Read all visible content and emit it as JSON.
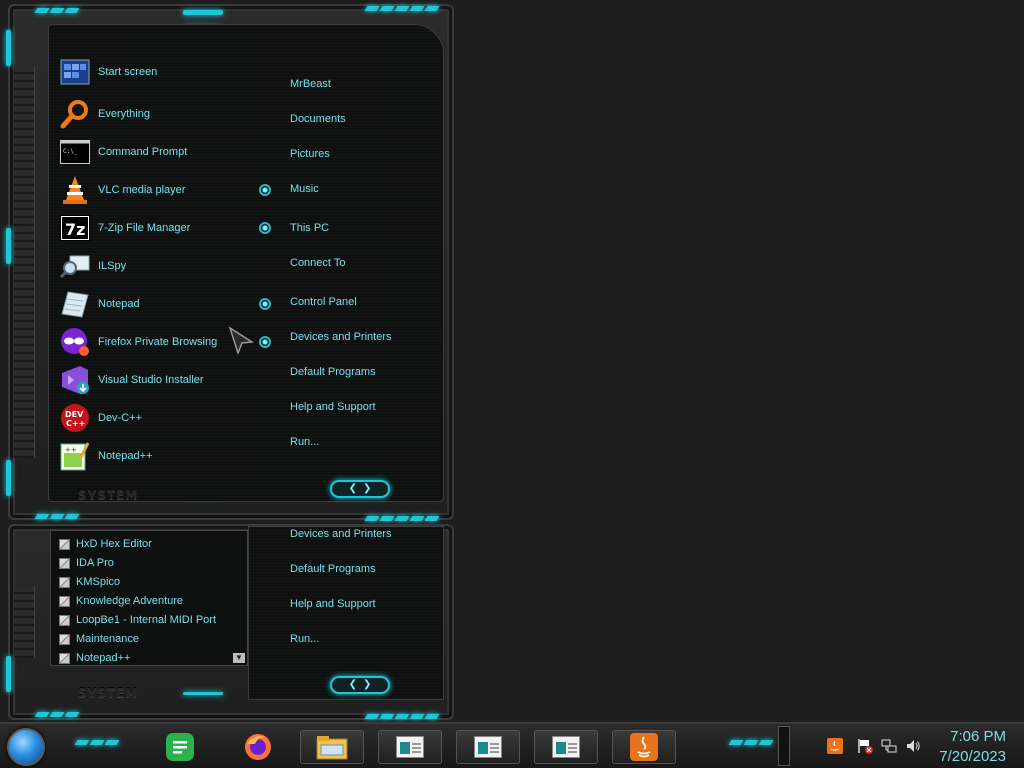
{
  "start_menu": {
    "system_label": "SYSTEM",
    "pinned": [
      {
        "label": "Start screen",
        "icon": "start-screen-icon"
      },
      {
        "label": "Everything",
        "icon": "magnifier-icon"
      },
      {
        "label": "Command Prompt",
        "icon": "terminal-icon"
      },
      {
        "label": "VLC media player",
        "icon": "vlc-cone-icon"
      },
      {
        "label": "7-Zip File Manager",
        "icon": "7zip-icon"
      },
      {
        "label": "ILSpy",
        "icon": "ilspy-icon"
      },
      {
        "label": "Notepad",
        "icon": "notepad-icon"
      },
      {
        "label": "Firefox Private Browsing",
        "icon": "firefox-private-icon"
      },
      {
        "label": "Visual Studio Installer",
        "icon": "visual-studio-icon"
      },
      {
        "label": "Dev-C++",
        "icon": "devcpp-icon"
      },
      {
        "label": "Notepad++",
        "icon": "notepadpp-icon"
      }
    ],
    "right_links": [
      "MrBeast",
      "Documents",
      "Pictures",
      "Music",
      "This PC",
      "Connect To",
      "Control Panel",
      "Devices and Printers",
      "Default Programs",
      "Help and Support",
      "Run..."
    ]
  },
  "all_programs": {
    "system_label": "SYSTEM",
    "items": [
      "HxD Hex Editor",
      "IDA Pro",
      "KMSpico",
      "Knowledge Adventure",
      "LoopBe1 - Internal MIDI Port",
      "Maintenance",
      "Notepad++"
    ],
    "right_links": [
      "Devices and Printers",
      "Default Programs",
      "Help and Support",
      "Run..."
    ]
  },
  "taskbar": {
    "time": "7:06 PM",
    "date": "7/20/2023",
    "apps": [
      "feedly-icon",
      "firefox-icon",
      "file-explorer-icon",
      "window-thumbnail",
      "window-thumbnail",
      "window-thumbnail",
      "java-icon"
    ],
    "tray": [
      "java-tray-icon",
      "action-center-flag-icon",
      "network-icon",
      "volume-icon"
    ]
  },
  "colors": {
    "accent": "#1ec6d6",
    "text": "#6fe3ef",
    "background": "#1d1d1d"
  }
}
